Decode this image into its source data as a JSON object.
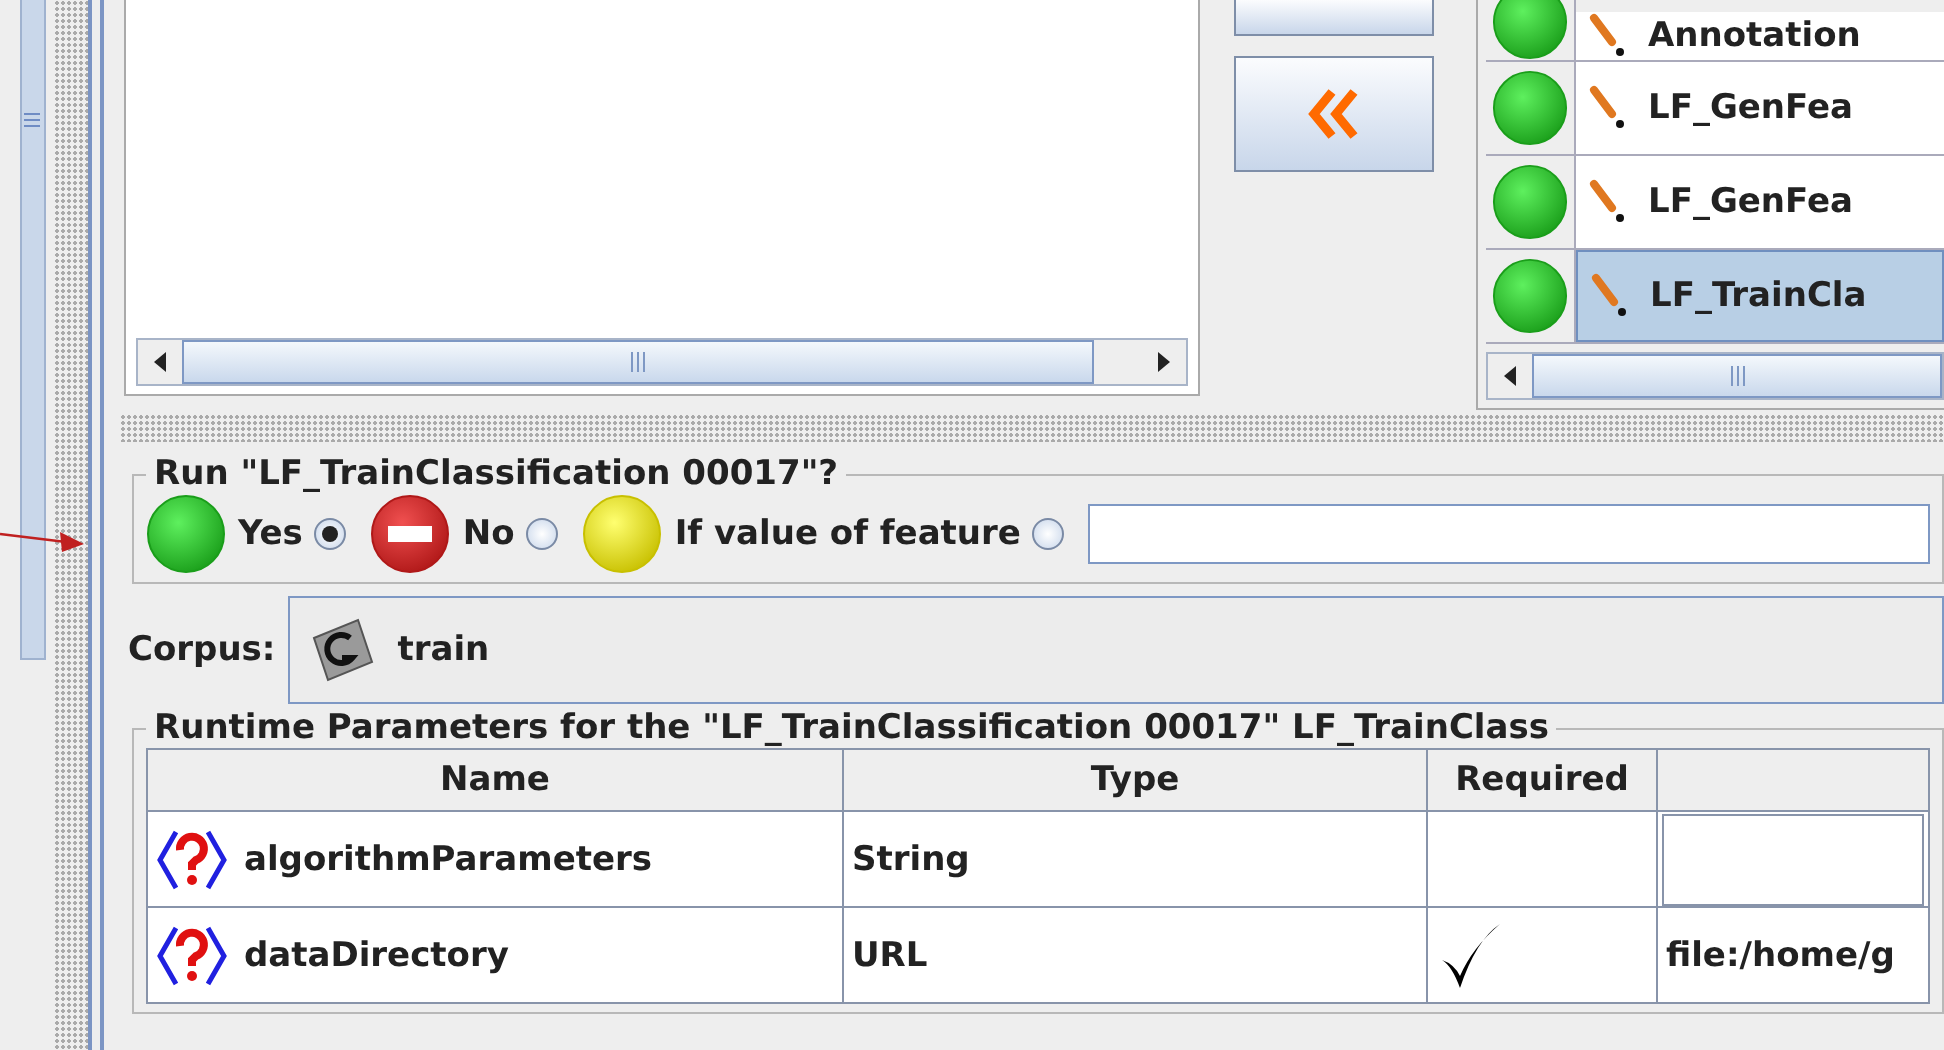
{
  "processing_resources": {
    "rows": [
      {
        "name": "Annotation",
        "selected": false
      },
      {
        "name": "LF_GenFea",
        "selected": false
      },
      {
        "name": "LF_GenFea",
        "selected": false
      },
      {
        "name": "LF_TrainCla",
        "selected": true
      }
    ]
  },
  "run_group": {
    "title": "Run \"LF_TrainClassification 00017\"?",
    "options": [
      {
        "kind": "yes",
        "label": "Yes",
        "selected": true
      },
      {
        "kind": "no",
        "label": "No",
        "selected": false
      },
      {
        "kind": "conditional",
        "label": "If value of feature",
        "selected": false
      }
    ]
  },
  "corpus": {
    "label": "Corpus:",
    "value": "train"
  },
  "parameters": {
    "title": "Runtime Parameters for the \"LF_TrainClassification 00017\" LF_TrainClass",
    "columns": [
      "Name",
      "Type",
      "Required"
    ],
    "rows": [
      {
        "name": "algorithmParameters",
        "type": "String",
        "required": false
      },
      {
        "name": "dataDirectory",
        "type": "URL",
        "required": true,
        "value": "file:/home/g"
      }
    ]
  }
}
